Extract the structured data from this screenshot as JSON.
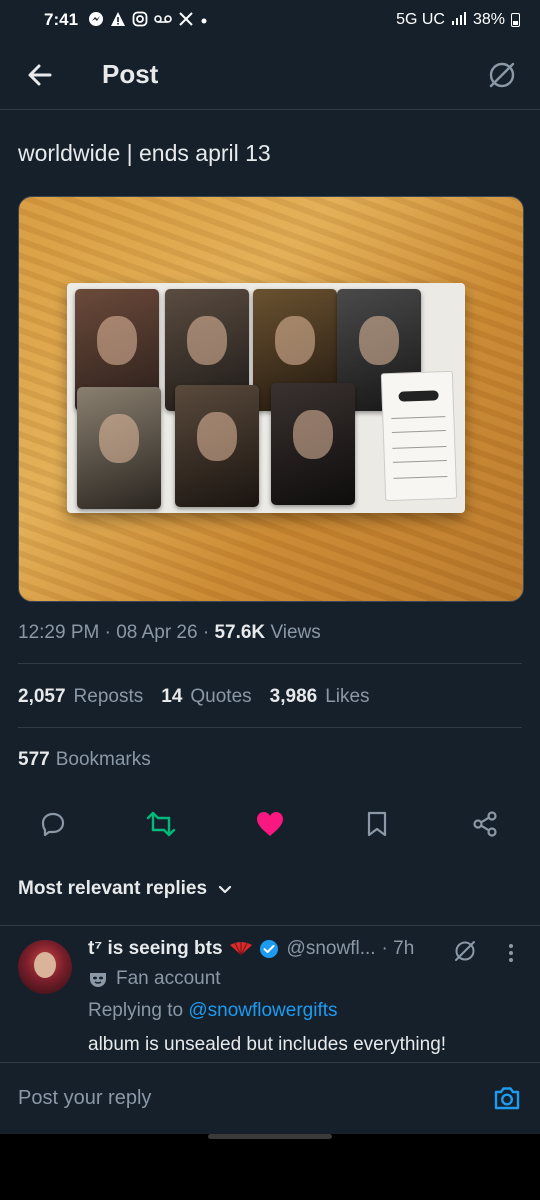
{
  "status_bar": {
    "time": "7:41",
    "network": "5G UC",
    "battery": "38%"
  },
  "header": {
    "title": "Post"
  },
  "post": {
    "text": "worldwide | ends april 13",
    "time": "12:29 PM",
    "date": "08 Apr 26",
    "views_count": "57.6K",
    "views_label": "Views",
    "reposts_count": "2,057",
    "reposts_label": "Reposts",
    "quotes_count": "14",
    "quotes_label": "Quotes",
    "likes_count": "3,986",
    "likes_label": "Likes",
    "bookmarks_count": "577",
    "bookmarks_label": "Bookmarks",
    "retweet_color": "#00ba7c",
    "like_color": "#f91880"
  },
  "replies": {
    "filter_label": "Most relevant replies",
    "items": [
      {
        "name": "t⁷ is seeing bts",
        "handle": "@snowfl...",
        "time": "· 7h",
        "account_label": "Fan account",
        "replying_prefix": "Replying to",
        "replying_to": "@snowflowergifts",
        "text": "album is unsealed but includes everything!"
      }
    ]
  },
  "composer": {
    "placeholder": "Post your reply"
  },
  "colors": {
    "background": "#15202b",
    "accent": "#1d9bf0",
    "muted": "#8b98a5"
  }
}
